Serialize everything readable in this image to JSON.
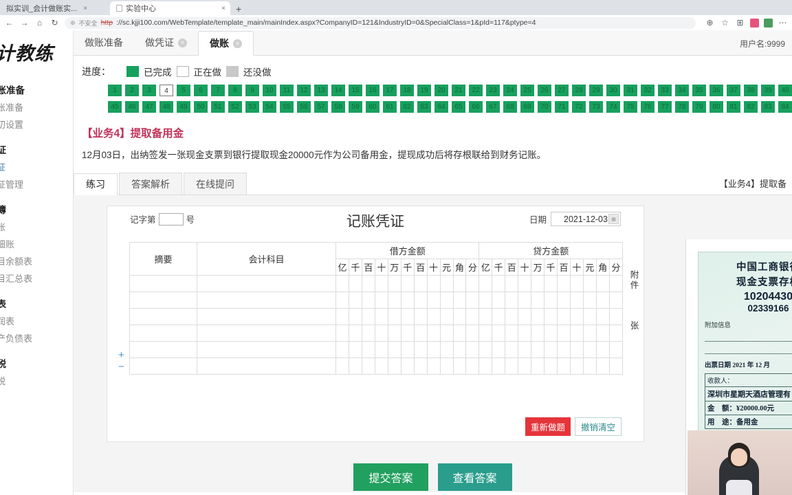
{
  "browser": {
    "tabs": [
      {
        "label": "拟实训_会计做账实...",
        "close": "×",
        "active": false
      },
      {
        "label": "实验中心",
        "close": "×",
        "active": true
      }
    ],
    "newtab_label": "+",
    "nav": {
      "back": "←",
      "forward": "→",
      "home": "⌂",
      "reload": "↻"
    },
    "url": {
      "shield": "⊕",
      "notsecure": "不安全",
      "scheme": "http",
      "rest": "://sc.kjji100.com/WebTemplate/template_main/mainIndex.aspx?CompanyID=121&IndustryID=0&SpecialClass=1&pId=117&ptype=4"
    },
    "actions": {
      "zoom": "⊕",
      "favorite": "☆",
      "collections": "⊞",
      "more": "⋯"
    }
  },
  "sidebar": {
    "brand": "会计教练",
    "groups": [
      {
        "header": "做账准备",
        "items": [
          {
            "label": "做账准备",
            "link": false
          },
          {
            "label": "期初设置",
            "link": false
          }
        ]
      },
      {
        "header": "凭证",
        "items": [
          {
            "label": "凭证",
            "link": true
          },
          {
            "label": "凭证管理",
            "link": false
          }
        ]
      },
      {
        "header": "账簿",
        "items": [
          {
            "label": "总账",
            "link": false
          },
          {
            "label": "明细账",
            "link": false
          },
          {
            "label": "科目余额表",
            "link": false
          },
          {
            "label": "科目汇总表",
            "link": false
          }
        ]
      },
      {
        "header": "报表",
        "items": [
          {
            "label": "利润表",
            "link": false
          },
          {
            "label": "资产负债表",
            "link": false
          }
        ]
      },
      {
        "header": "报税",
        "items": [
          {
            "label": "报税",
            "link": false
          }
        ]
      }
    ]
  },
  "top_tabs": [
    {
      "label": "做账准备",
      "closable": false,
      "active": false
    },
    {
      "label": "做凭证",
      "closable": true,
      "active": false
    },
    {
      "label": "做账",
      "closable": true,
      "active": true
    }
  ],
  "close_glyph": "×",
  "user_info": "用户名:9999",
  "progress": {
    "label": "进度：",
    "legend": [
      {
        "state": "done",
        "label": "已完成"
      },
      {
        "state": "doing",
        "label": "正在做"
      },
      {
        "state": "todo",
        "label": "还没做"
      }
    ],
    "current": 4,
    "total": 85
  },
  "business": {
    "title": "【业务4】提取备用金",
    "desc": "12月03日，出纳签发一张现金支票到银行提取现金20000元作为公司备用金，提现成功后将存根联给到财务记账。"
  },
  "sub_tabs": [
    {
      "label": "练习",
      "active": true
    },
    {
      "label": "答案解析",
      "active": false
    },
    {
      "label": "在线提问",
      "active": false
    }
  ],
  "sub_right_title": "【业务4】提取备",
  "voucher": {
    "prefix": "记字第",
    "number_value": "",
    "suffix": "号",
    "title": "记账凭证",
    "date_label": "日期",
    "date_value": "2021-12-03",
    "calendar_icon": "▦",
    "columns": {
      "summary": "摘要",
      "account": "会计科目",
      "debit": "借方金额",
      "credit": "贷方金额"
    },
    "digits": [
      "亿",
      "千",
      "百",
      "十",
      "万",
      "千",
      "百",
      "十",
      "元",
      "角",
      "分"
    ],
    "rows": 6,
    "attach_label": "附件",
    "attach_unit": "张",
    "add_row": "+",
    "remove_row": "−",
    "buttons": {
      "redo": "重新做题",
      "undo": "撤销清空"
    }
  },
  "bottom_buttons": {
    "submit": "提交答案",
    "view": "查看答案"
  },
  "cheque": {
    "bank": "中国工商银行",
    "type": "现金支票存根",
    "no1": "10204430",
    "no2": "02339166",
    "addinfo_label": "附加信息",
    "issue_label": "出票日期",
    "year": "2021",
    "year_unit": "年",
    "month": "12",
    "month_unit": "月",
    "payee_label": "收款人：",
    "payee": "深圳市星期天酒店管理有",
    "amount_label": "金　额：",
    "amount": "¥20000.00元",
    "purpose_label": "用　途：",
    "purpose": "备用金"
  },
  "colors": {
    "green": "#18a05e",
    "red": "#e5353a",
    "pink": "#c0325a",
    "teal": "#2a9d8c"
  }
}
